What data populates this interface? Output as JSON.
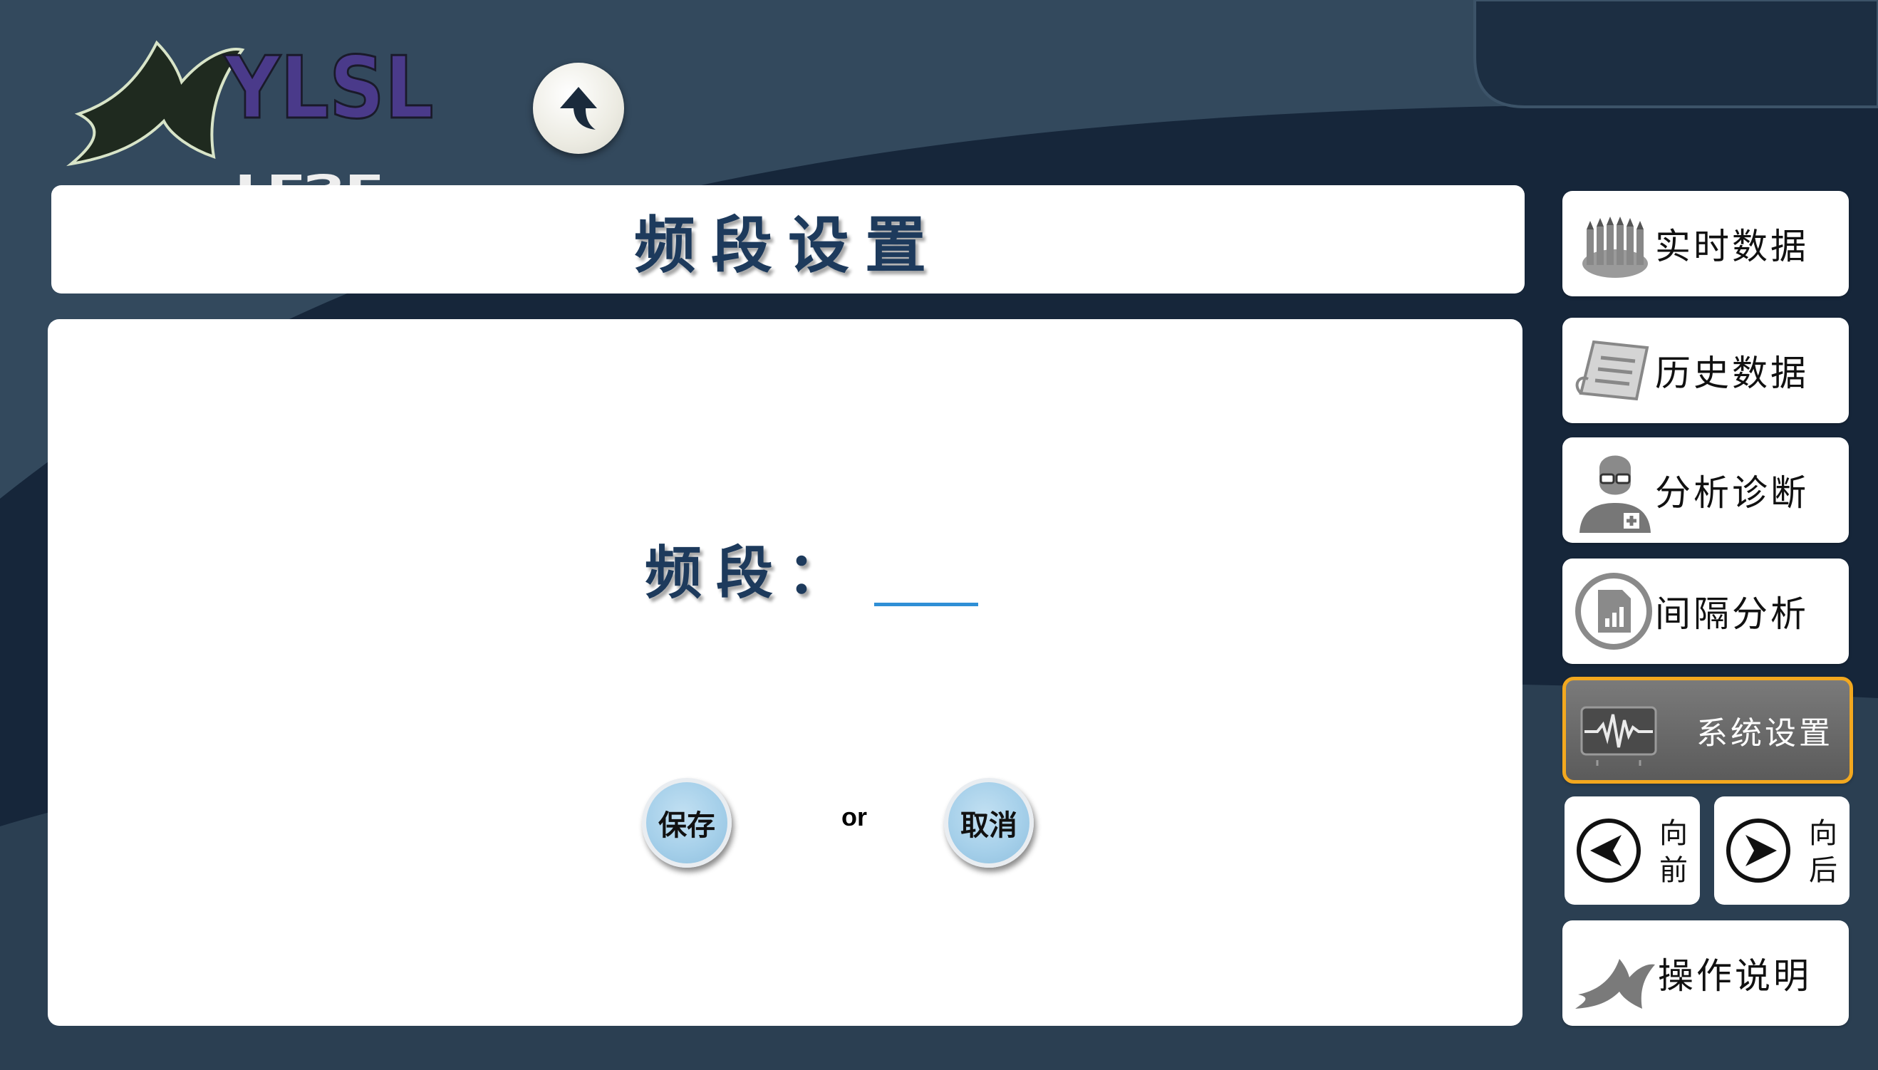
{
  "page": {
    "title": "频段设置"
  },
  "logo": {
    "text": "YLSL"
  },
  "toolbar": {
    "up_icon": "up-arrow-icon"
  },
  "form": {
    "freq_label": "频段：",
    "freq_value": "",
    "save_label": "保存",
    "or_text": "or",
    "cancel_label": "取消"
  },
  "sidebar": {
    "items": [
      {
        "label": "实时数据",
        "icon": "pencils-icon"
      },
      {
        "label": "历史数据",
        "icon": "document-list-icon"
      },
      {
        "label": "分析诊断",
        "icon": "doctor-icon"
      },
      {
        "label": "间隔分析",
        "icon": "report-chart-icon"
      },
      {
        "label": "系统设置",
        "icon": "waveform-icon",
        "active": true
      }
    ],
    "prev_label": "向前",
    "next_label": "向后",
    "help_label": "操作说明"
  },
  "colors": {
    "background": "#33495d",
    "accent_dark": "#16263a",
    "title_text": "#1d3a5c",
    "input_underline": "#2f8fd6",
    "button_fill": "#a6d0ea",
    "active_border": "#f2a81f",
    "active_fill": "#666666"
  }
}
